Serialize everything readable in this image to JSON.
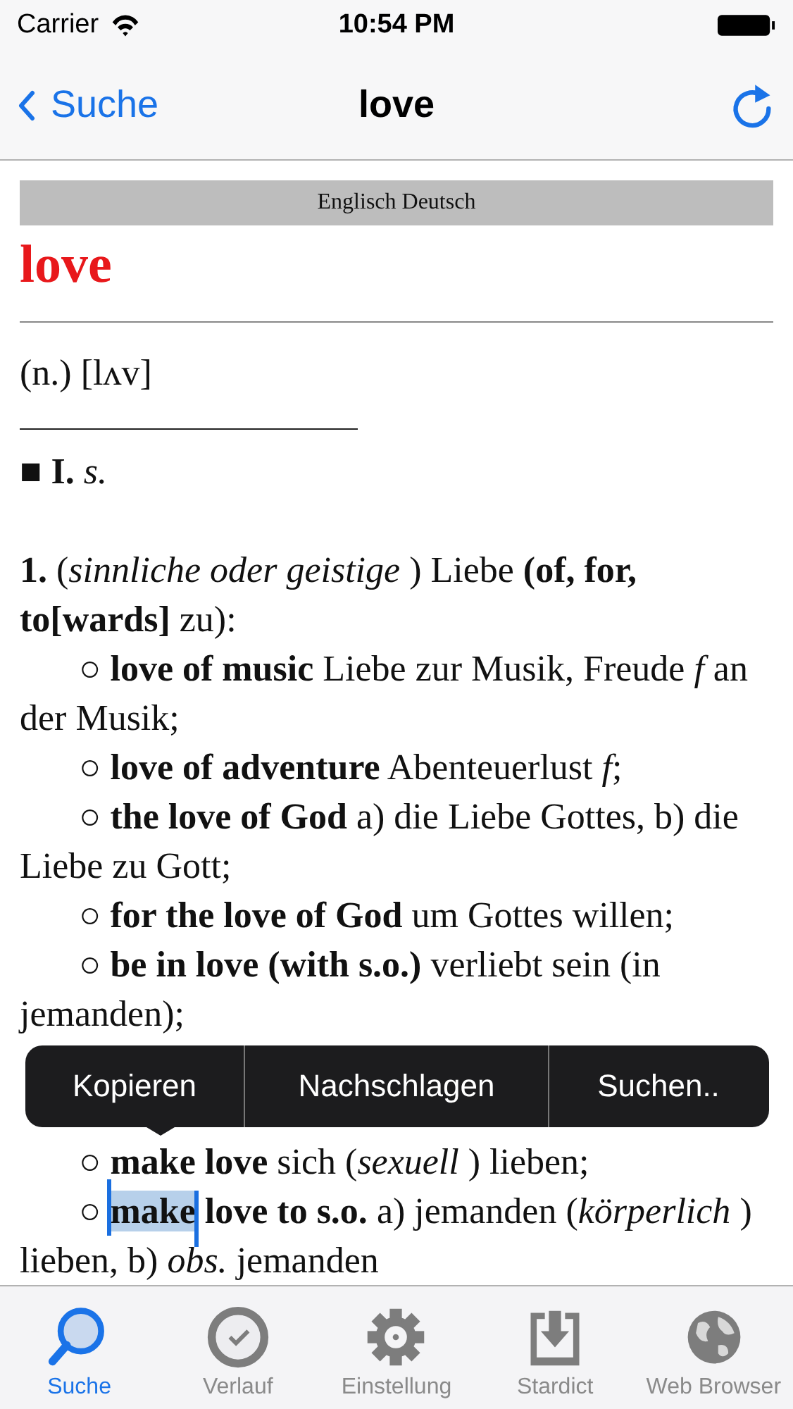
{
  "status_bar": {
    "carrier": "Carrier",
    "time": "10:54 PM"
  },
  "nav_bar": {
    "back_label": "Suche",
    "title": "love"
  },
  "entry": {
    "language_pair": "Englisch Deutsch",
    "headword": "love",
    "pronunciation": "(n.) [lʌv]",
    "lines": [
      {
        "kind": "heading",
        "segments": [
          {
            "text": "■ **I.** *s.*",
            "selected": false
          }
        ]
      },
      {
        "kind": "blank"
      },
      {
        "kind": "sense",
        "segments": [
          {
            "text": "**1.** (*sinnliche oder geistige* ) Liebe **(of, for, to[wards]** zu):",
            "selected": false
          }
        ]
      },
      {
        "kind": "example",
        "segments": [
          {
            "text": "○ **love of music** Liebe zur Musik, Freude *f* an der Musik;",
            "selected": false
          }
        ]
      },
      {
        "kind": "example",
        "segments": [
          {
            "text": "○ **love of adventure** Abenteuerlust *f*;",
            "selected": false
          }
        ]
      },
      {
        "kind": "example",
        "segments": [
          {
            "text": "○ **the love of God** a) die Liebe Gottes, b) die Liebe zu Gott;",
            "selected": false
          }
        ]
      },
      {
        "kind": "example",
        "segments": [
          {
            "text": "○ **for the love of God** um Gottes willen;",
            "selected": false
          }
        ]
      },
      {
        "kind": "example",
        "segments": [
          {
            "text": "○ **be in love (with s.o.)** verliebt sein (in jemanden);",
            "selected": false
          }
        ]
      },
      {
        "kind": "covered"
      },
      {
        "kind": "example",
        "segments": [
          {
            "text": "○ **make love** sich (*sexuell* ) lieben;",
            "selected": false
          }
        ]
      },
      {
        "kind": "example",
        "segments": [
          {
            "text": "○ ",
            "selected": false
          },
          {
            "text": "**make**",
            "selected": true
          },
          {
            "text": " **love to s.o.** a) jemanden (*körperlich* ) lieben, b) *obs.* jemanden",
            "selected": false
          }
        ]
      }
    ]
  },
  "context_menu": [
    "Kopieren",
    "Nachschlagen",
    "Suchen.."
  ],
  "tab_bar": [
    {
      "label": "Suche",
      "selected": true
    },
    {
      "label": "Verlauf",
      "selected": false
    },
    {
      "label": "Einstellung",
      "selected": false
    },
    {
      "label": "Stardict",
      "selected": false
    },
    {
      "label": "Web Browser",
      "selected": false
    }
  ]
}
